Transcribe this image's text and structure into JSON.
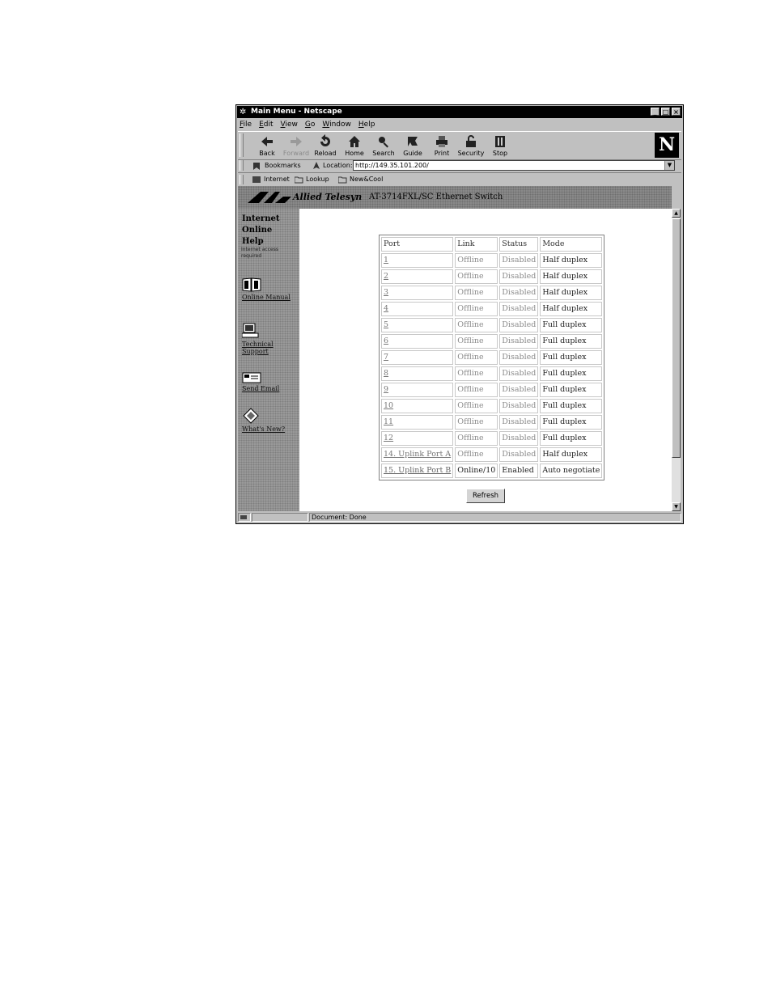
{
  "window": {
    "title": "Main Menu - Netscape",
    "min": "_",
    "max": "□",
    "close": "×"
  },
  "menu": [
    "File",
    "Edit",
    "View",
    "Go",
    "Window",
    "Help"
  ],
  "toolbar": [
    {
      "label": "Back",
      "icon": "back-icon",
      "enabled": true
    },
    {
      "label": "Forward",
      "icon": "forward-icon",
      "enabled": false
    },
    {
      "label": "Reload",
      "icon": "reload-icon",
      "enabled": true
    },
    {
      "label": "Home",
      "icon": "home-icon",
      "enabled": true
    },
    {
      "label": "Search",
      "icon": "search-icon",
      "enabled": true
    },
    {
      "label": "Guide",
      "icon": "guide-icon",
      "enabled": true
    },
    {
      "label": "Print",
      "icon": "print-icon",
      "enabled": true
    },
    {
      "label": "Security",
      "icon": "security-icon",
      "enabled": true
    },
    {
      "label": "Stop",
      "icon": "stop-icon",
      "enabled": true
    }
  ],
  "netscape_logo": "N",
  "location": {
    "bookmarks": "Bookmarks",
    "label": "Location:",
    "url": "http://149.35.101.200/"
  },
  "personal": [
    "Internet",
    "Lookup",
    "New&Cool"
  ],
  "banner": {
    "brand": "Allied Telesyn",
    "product": "AT-3714FXL/SC Ethernet Switch"
  },
  "sidebar": {
    "heading": [
      "Internet",
      "Online",
      "Help"
    ],
    "subtext": "Internet access required",
    "links": [
      {
        "label": "Online Manual",
        "icon": "book-icon"
      },
      {
        "label": "Technical Support",
        "icon": "computer-icon"
      },
      {
        "label": "Send Email",
        "icon": "mail-icon"
      },
      {
        "label": "What's New?",
        "icon": "diamond-icon"
      }
    ]
  },
  "table": {
    "headers": {
      "port": "Port",
      "link": "Link",
      "status": "Status",
      "mode": "Mode"
    },
    "rows": [
      {
        "port": "1",
        "link": "Offline",
        "status": "Disabled",
        "mode": "Half duplex"
      },
      {
        "port": "2",
        "link": "Offline",
        "status": "Disabled",
        "mode": "Half duplex"
      },
      {
        "port": "3",
        "link": "Offline",
        "status": "Disabled",
        "mode": "Half duplex"
      },
      {
        "port": "4",
        "link": "Offline",
        "status": "Disabled",
        "mode": "Half duplex"
      },
      {
        "port": "5",
        "link": "Offline",
        "status": "Disabled",
        "mode": "Full duplex"
      },
      {
        "port": "6",
        "link": "Offline",
        "status": "Disabled",
        "mode": "Full duplex"
      },
      {
        "port": "7",
        "link": "Offline",
        "status": "Disabled",
        "mode": "Full duplex"
      },
      {
        "port": "8",
        "link": "Offline",
        "status": "Disabled",
        "mode": "Full duplex"
      },
      {
        "port": "9",
        "link": "Offline",
        "status": "Disabled",
        "mode": "Full duplex"
      },
      {
        "port": "10",
        "link": "Offline",
        "status": "Disabled",
        "mode": "Full duplex"
      },
      {
        "port": "11",
        "link": "Offline",
        "status": "Disabled",
        "mode": "Full duplex"
      },
      {
        "port": "12",
        "link": "Offline",
        "status": "Disabled",
        "mode": "Full duplex"
      },
      {
        "port": "14. Uplink Port A",
        "link": "Offline",
        "status": "Disabled",
        "mode": "Half duplex"
      },
      {
        "port": "15. Uplink Port B",
        "link": "Online/10",
        "status": "Enabled",
        "mode": "Auto negotiate",
        "online": true
      }
    ]
  },
  "refresh_label": "Refresh",
  "status_text": "Document: Done"
}
